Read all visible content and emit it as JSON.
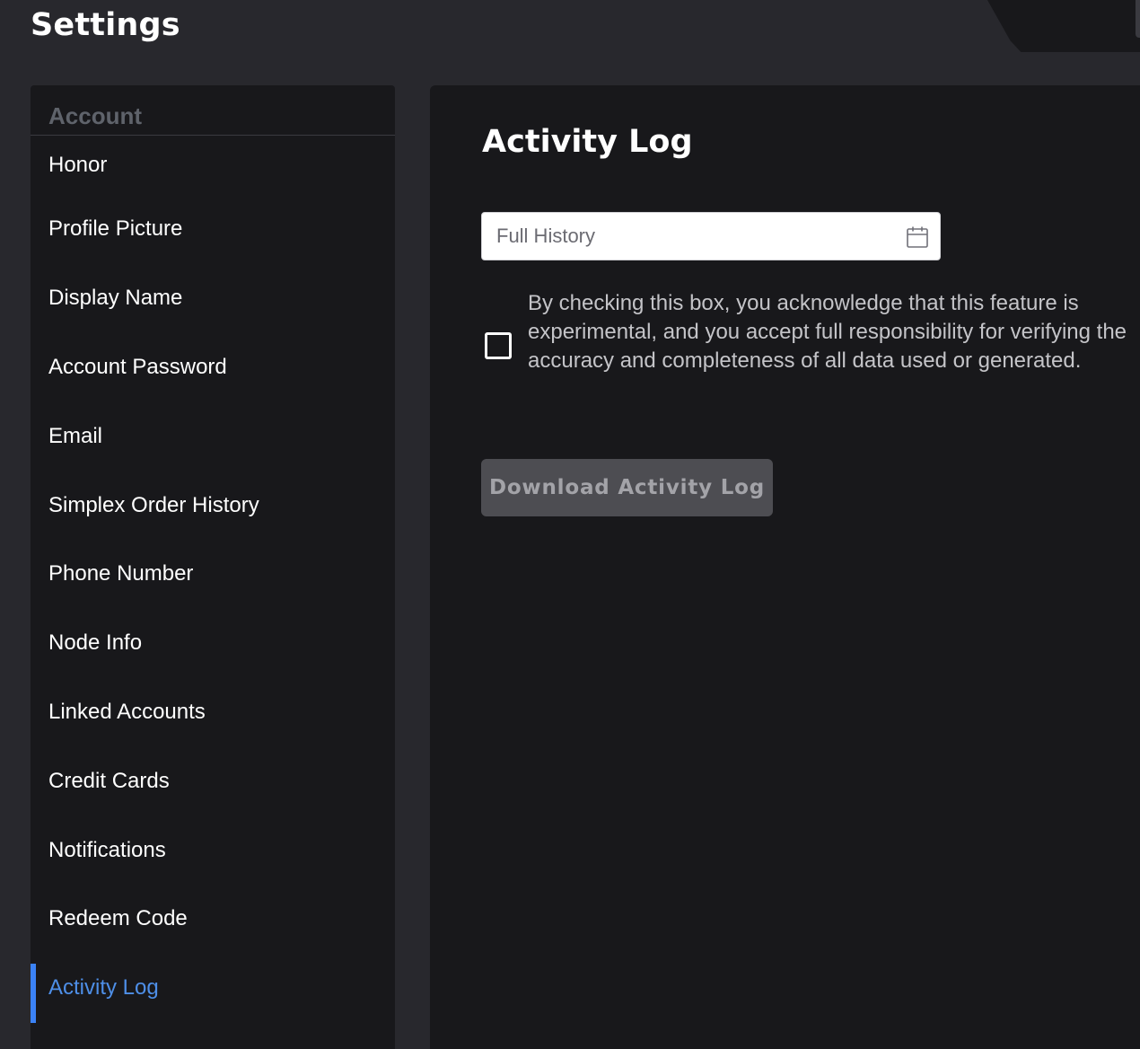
{
  "page": {
    "title": "Settings"
  },
  "sidebar": {
    "section_title": "Account",
    "items": [
      {
        "label": "Honor"
      },
      {
        "label": "Profile Picture"
      },
      {
        "label": "Display Name"
      },
      {
        "label": "Account Password"
      },
      {
        "label": "Email"
      },
      {
        "label": "Simplex Order History"
      },
      {
        "label": "Phone Number"
      },
      {
        "label": "Node Info"
      },
      {
        "label": "Linked Accounts"
      },
      {
        "label": "Credit Cards"
      },
      {
        "label": "Notifications"
      },
      {
        "label": "Redeem Code"
      },
      {
        "label": "Activity Log"
      }
    ],
    "active_item": "Activity Log"
  },
  "main": {
    "title": "Activity Log",
    "date_range": {
      "placeholder": "Full History",
      "value": "",
      "icon": "calendar-icon"
    },
    "consent": {
      "checked": false,
      "text": "By checking this box, you acknowledge that this feature is experimental, and you accept full responsibility for verifying the accuracy and completeness of all data used or generated."
    },
    "download_button": {
      "label": "Download Activity Log",
      "disabled": true
    }
  },
  "colors": {
    "background": "#28282d",
    "panel": "#18181b",
    "accent": "#3b82f6",
    "active_text": "#4e8fe8",
    "muted_header": "#5f636b",
    "button_disabled_bg": "#4d4d52",
    "button_disabled_text": "#a3a3a8"
  }
}
